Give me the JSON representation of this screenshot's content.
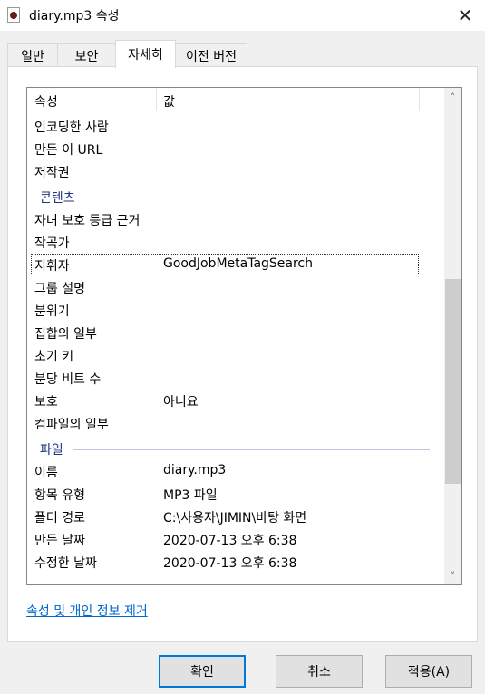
{
  "window": {
    "title": "diary.mp3 속성",
    "close_glyph": "✕"
  },
  "tabs": [
    {
      "label": "일반"
    },
    {
      "label": "보안"
    },
    {
      "label": "자세히",
      "active": true
    },
    {
      "label": "이전 버전"
    }
  ],
  "list": {
    "col_property": "속성",
    "col_value": "값",
    "scroll_up": "˄",
    "scroll_down": "˅",
    "rows_top": [
      {
        "name": "인코딩한 사람",
        "value": ""
      },
      {
        "name": "만든 이 URL",
        "value": ""
      },
      {
        "name": "저작권",
        "value": ""
      }
    ],
    "group_content": "콘텐츠",
    "rows_content": [
      {
        "name": "자녀 보호 등급 근거",
        "value": ""
      },
      {
        "name": "작곡가",
        "value": ""
      },
      {
        "name": "지휘자",
        "value": "GoodJobMetaTagSearch",
        "selected": true
      },
      {
        "name": "그룹 설명",
        "value": ""
      },
      {
        "name": "분위기",
        "value": ""
      },
      {
        "name": "집합의 일부",
        "value": ""
      },
      {
        "name": "초기 키",
        "value": ""
      },
      {
        "name": "분당 비트 수",
        "value": ""
      },
      {
        "name": "보호",
        "value": "아니요"
      },
      {
        "name": "컴파일의 일부",
        "value": ""
      }
    ],
    "group_file": "파일",
    "rows_file": [
      {
        "name": "이름",
        "value": "diary.mp3"
      },
      {
        "name": "항목 유형",
        "value": "MP3 파일"
      },
      {
        "name": "폴더 경로",
        "value": "C:\\사용자\\JIMIN\\바탕 화면"
      },
      {
        "name": "만든 날짜",
        "value": "2020-07-13 오후 6:38"
      },
      {
        "name": "수정한 날짜",
        "value": "2020-07-13 오후 6:38"
      }
    ]
  },
  "remove_link": "속성 및 개인 정보 제거",
  "buttons": {
    "ok": "확인",
    "cancel": "취소",
    "apply": "적용(A)"
  }
}
